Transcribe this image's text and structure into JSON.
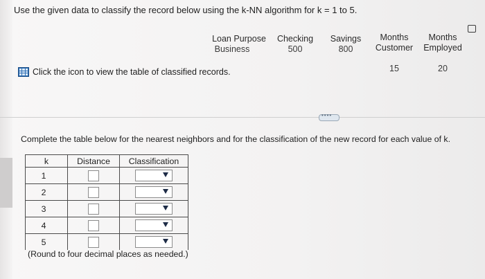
{
  "question": "Use the given data to classify the record below using the k-NN algorithm for k = 1 to 5.",
  "record": {
    "columns": [
      {
        "header": "Loan Purpose",
        "value": "Business"
      },
      {
        "header": "Checking",
        "value": "500"
      },
      {
        "header": "Savings",
        "value": "800"
      },
      {
        "header": "Months\nCustomer",
        "value": "15"
      },
      {
        "header": "Months\nEmployed",
        "value": "20"
      }
    ]
  },
  "icon_link_text": "Click the icon to view the table of classified records.",
  "instructions": "Complete the table below for the nearest neighbors and for the classification of the new record for each value of k.",
  "answer_table": {
    "headers": [
      "k",
      "Distance",
      "Classification"
    ],
    "rows": [
      {
        "k": "1",
        "distance": "",
        "classification": ""
      },
      {
        "k": "2",
        "distance": "",
        "classification": ""
      },
      {
        "k": "3",
        "distance": "",
        "classification": ""
      },
      {
        "k": "4",
        "distance": "",
        "classification": ""
      },
      {
        "k": "5",
        "distance": "",
        "classification": ""
      }
    ]
  },
  "round_note": "(Round to four decimal places as needed.)",
  "icons": {
    "table_icon": "grid-table-icon",
    "copy_icon": "copy-icon",
    "dropdown_icon": "chevron-down-icon"
  }
}
